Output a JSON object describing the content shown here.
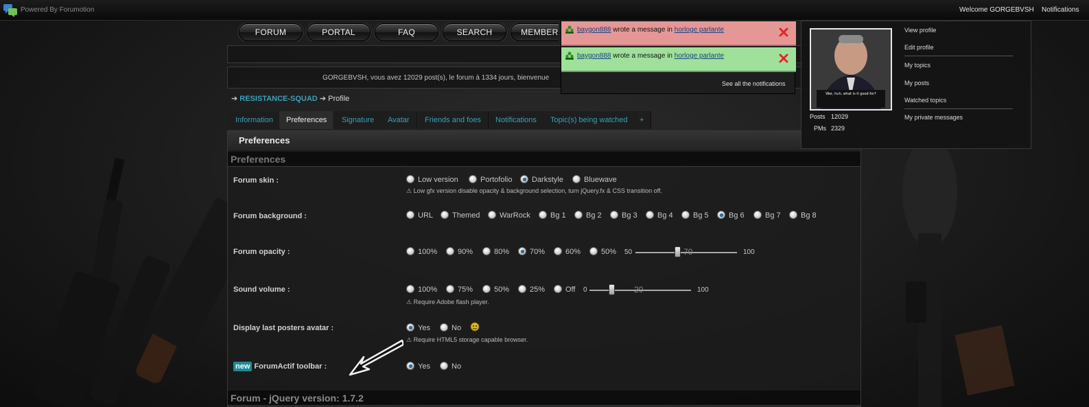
{
  "colors": {
    "accent_teal": "#3aa0b8",
    "notif_red": "#e59796",
    "notif_green": "#9fe19a",
    "badge_new": "#1f8a94"
  },
  "topbar": {
    "logo_icon": "forumactif-chat-icon",
    "powered_by": "Powered By Forumotion",
    "welcome": "Welcome GORGEBVSH",
    "notifications_label": "Notifications"
  },
  "nav": {
    "items": [
      "FORUM",
      "PORTAL",
      "FAQ",
      "SEARCH",
      "MEMBERS"
    ]
  },
  "welcome_message": "GORGEBVSH, vous avez 12029 post(s), le forum à 1334 jours, bienvenue",
  "breadcrumb": {
    "site": "RESISTANCE-SQUAD",
    "current": "Profile"
  },
  "tabs": [
    "Information",
    "Preferences",
    "Signature",
    "Avatar",
    "Friends and foes",
    "Notifications",
    "Topic(s) being watched",
    "+"
  ],
  "panel": {
    "title": "Preferences",
    "section_head": "Preferences",
    "footer_section": "Forum - jQuery version: 1.7.2"
  },
  "rows": {
    "skin": {
      "label": "Forum skin :",
      "options": [
        "Low version",
        "Portofolio",
        "Darkstyle",
        "Bluewave"
      ],
      "selected": "Darkstyle",
      "hint": "⚠ Low gfx version disable opacity & background selection, turn jQuery.fx & CSS transition off."
    },
    "background": {
      "label": "Forum background :",
      "options": [
        "URL",
        "Themed",
        "WarRock",
        "Bg 1",
        "Bg 2",
        "Bg 3",
        "Bg 4",
        "Bg 5",
        "Bg 6",
        "Bg 7",
        "Bg 8"
      ],
      "selected": "Bg 6"
    },
    "opacity": {
      "label": "Forum opacity :",
      "options": [
        "100%",
        "90%",
        "80%",
        "70%",
        "60%",
        "50%"
      ],
      "selected": "70%",
      "slider_min": "50",
      "slider_max": "100",
      "slider_value": "70"
    },
    "sound": {
      "label": "Sound volume :",
      "options": [
        "100%",
        "75%",
        "50%",
        "25%",
        "Off"
      ],
      "selected": null,
      "slider_min": "0",
      "slider_max": "100",
      "slider_value": "20",
      "hint": "⚠ Require Adobe flash player."
    },
    "avatar": {
      "label": "Display last posters avatar :",
      "options": [
        "Yes",
        "No"
      ],
      "selected": "Yes",
      "hint": "⚠ Require HTML5 storage capable browser."
    },
    "toolbar": {
      "badge": "new",
      "label": "ForumActif toolbar :",
      "options": [
        "Yes",
        "No"
      ],
      "selected": "Yes"
    }
  },
  "notifications": {
    "items": [
      {
        "user": "baygon888",
        "text": "wrote a message in",
        "topic": "horloge parlante"
      },
      {
        "user": "baygon888",
        "text": "wrote a message in",
        "topic": "horloge parlante"
      }
    ],
    "see_all": "See all the notifications"
  },
  "profile_menu": {
    "avatar_caption": "War, huh, what is it good for?",
    "posts_label": "Posts",
    "posts_value": "12029",
    "pms_label": "PMs",
    "pms_value": "2329",
    "items": [
      "View profile",
      "Edit profile",
      "My topics",
      "My posts",
      "Watched topics",
      "My private messages"
    ]
  }
}
